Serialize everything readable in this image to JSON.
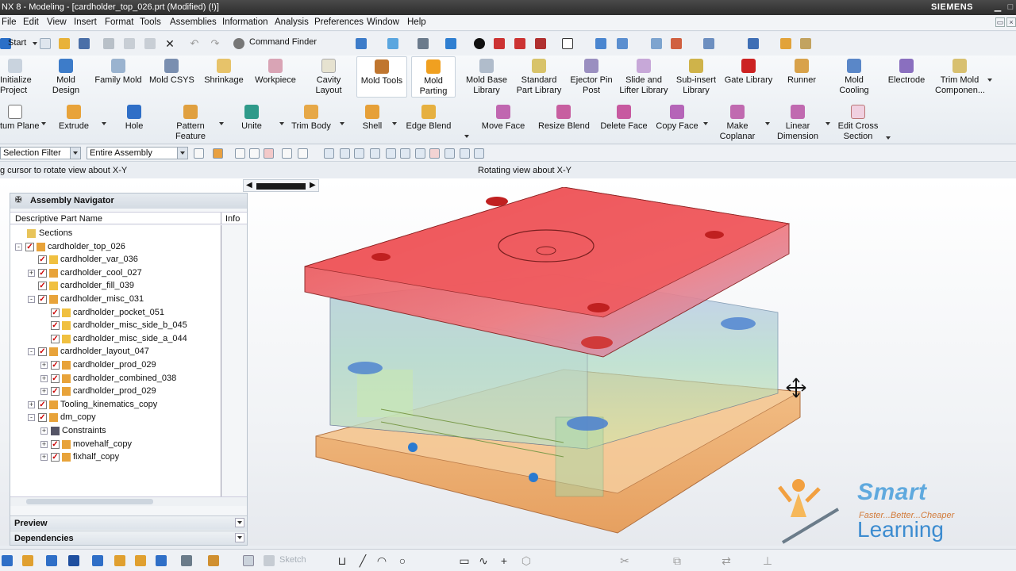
{
  "titlebar": {
    "title": "NX 8 - Modeling - [cardholder_top_026.prt (Modified)   (!)]",
    "brand": "SIEMENS"
  },
  "menu": [
    "File",
    "Edit",
    "View",
    "Insert",
    "Format",
    "Tools",
    "Assemblies",
    "Information",
    "Analysis",
    "Preferences",
    "Window",
    "Help"
  ],
  "quickbar": {
    "start": "Start",
    "command_finder": "Command Finder"
  },
  "ribbon_row1": [
    {
      "label": "Initialize\nProject",
      "icon": "initialize-project-icon"
    },
    {
      "label": "Mold\nDesign",
      "icon": "mold-design-icon"
    },
    {
      "label": "Family Mold",
      "icon": "family-mold-icon"
    },
    {
      "label": "Mold CSYS",
      "icon": "mold-csys-icon"
    },
    {
      "label": "Shrinkage",
      "icon": "shrinkage-icon"
    },
    {
      "label": "Workpiece",
      "icon": "workpiece-icon"
    },
    {
      "label": "Cavity\nLayout",
      "icon": "cavity-layout-icon"
    },
    {
      "label": "Mold Tools",
      "icon": "mold-tools-icon"
    },
    {
      "label": "Mold\nParting",
      "icon": "mold-parting-icon"
    },
    {
      "label": "Mold Base\nLibrary",
      "icon": "mold-base-library-icon"
    },
    {
      "label": "Standard\nPart Library",
      "icon": "standard-part-library-icon"
    },
    {
      "label": "Ejector Pin\nPost",
      "icon": "ejector-pin-post-icon"
    },
    {
      "label": "Slide and\nLifter Library",
      "icon": "slide-lifter-library-icon"
    },
    {
      "label": "Sub-insert\nLibrary",
      "icon": "sub-insert-library-icon"
    },
    {
      "label": "Gate Library",
      "icon": "gate-library-icon"
    },
    {
      "label": "Runner",
      "icon": "runner-icon"
    },
    {
      "label": "Mold\nCooling",
      "icon": "mold-cooling-icon"
    },
    {
      "label": "Electrode",
      "icon": "electrode-icon"
    },
    {
      "label": "Trim Mold\nComponen...",
      "icon": "trim-mold-components-icon"
    }
  ],
  "ribbon_row2": [
    {
      "label": "tum Plane",
      "icon": "datum-plane-icon"
    },
    {
      "label": "Extrude",
      "icon": "extrude-icon"
    },
    {
      "label": "Hole",
      "icon": "hole-icon"
    },
    {
      "label": "Pattern\nFeature",
      "icon": "pattern-feature-icon"
    },
    {
      "label": "Unite",
      "icon": "unite-icon"
    },
    {
      "label": "Trim Body",
      "icon": "trim-body-icon"
    },
    {
      "label": "Shell",
      "icon": "shell-icon"
    },
    {
      "label": "Edge Blend",
      "icon": "edge-blend-icon"
    },
    {
      "label": "Move Face",
      "icon": "move-face-icon"
    },
    {
      "label": "Resize Blend",
      "icon": "resize-blend-icon"
    },
    {
      "label": "Delete Face",
      "icon": "delete-face-icon"
    },
    {
      "label": "Copy Face",
      "icon": "copy-face-icon"
    },
    {
      "label": "Make\nCoplanar",
      "icon": "make-coplanar-icon"
    },
    {
      "label": "Linear\nDimension",
      "icon": "linear-dimension-icon"
    },
    {
      "label": "Edit Cross\nSection",
      "icon": "edit-cross-section-icon"
    }
  ],
  "selection": {
    "filter": "Selection Filter",
    "scope": "Entire Assembly"
  },
  "status": {
    "cue": "g cursor to rotate view about X-Y",
    "status": "Rotating view about X-Y"
  },
  "navigator": {
    "title": "Assembly Navigator",
    "col_name": "Descriptive Part Name",
    "col_info": "Info",
    "rows": [
      {
        "label": "Sections",
        "level": 0,
        "expander": "",
        "checked": false,
        "kind": "folder"
      },
      {
        "label": "cardholder_top_026",
        "level": 0,
        "expander": "-",
        "checked": true,
        "kind": "assembly"
      },
      {
        "label": "cardholder_var_036",
        "level": 1,
        "expander": "",
        "checked": true,
        "kind": "part"
      },
      {
        "label": "cardholder_cool_027",
        "level": 1,
        "expander": "+",
        "checked": true,
        "kind": "assembly"
      },
      {
        "label": "cardholder_fill_039",
        "level": 1,
        "expander": "",
        "checked": true,
        "kind": "part"
      },
      {
        "label": "cardholder_misc_031",
        "level": 1,
        "expander": "-",
        "checked": true,
        "kind": "assembly"
      },
      {
        "label": "cardholder_pocket_051",
        "level": 2,
        "expander": "",
        "checked": true,
        "kind": "part"
      },
      {
        "label": "cardholder_misc_side_b_045",
        "level": 2,
        "expander": "",
        "checked": true,
        "kind": "part"
      },
      {
        "label": "cardholder_misc_side_a_044",
        "level": 2,
        "expander": "",
        "checked": true,
        "kind": "part"
      },
      {
        "label": "cardholder_layout_047",
        "level": 1,
        "expander": "-",
        "checked": true,
        "kind": "assembly"
      },
      {
        "label": "cardholder_prod_029",
        "level": 2,
        "expander": "+",
        "checked": true,
        "kind": "assembly"
      },
      {
        "label": "cardholder_combined_038",
        "level": 2,
        "expander": "+",
        "checked": true,
        "kind": "assembly"
      },
      {
        "label": "cardholder_prod_029",
        "level": 2,
        "expander": "+",
        "checked": true,
        "kind": "assembly"
      },
      {
        "label": "Tooling_kinematics_copy",
        "level": 1,
        "expander": "+",
        "checked": true,
        "kind": "assembly"
      },
      {
        "label": "dm_copy",
        "level": 1,
        "expander": "-",
        "checked": true,
        "kind": "assembly"
      },
      {
        "label": "Constraints",
        "level": 2,
        "expander": "+",
        "checked": false,
        "kind": "constraint"
      },
      {
        "label": "movehalf_copy",
        "level": 2,
        "expander": "+",
        "checked": true,
        "kind": "assembly"
      },
      {
        "label": "fixhalf_copy",
        "level": 2,
        "expander": "+",
        "checked": true,
        "kind": "assembly"
      }
    ],
    "panels": [
      "Preview",
      "Dependencies"
    ]
  },
  "bottom": {
    "sketch_label": "Sketch"
  },
  "logo": {
    "smart": "Smart",
    "tagline": "Faster...Better...Cheaper",
    "learning": "Learning"
  }
}
